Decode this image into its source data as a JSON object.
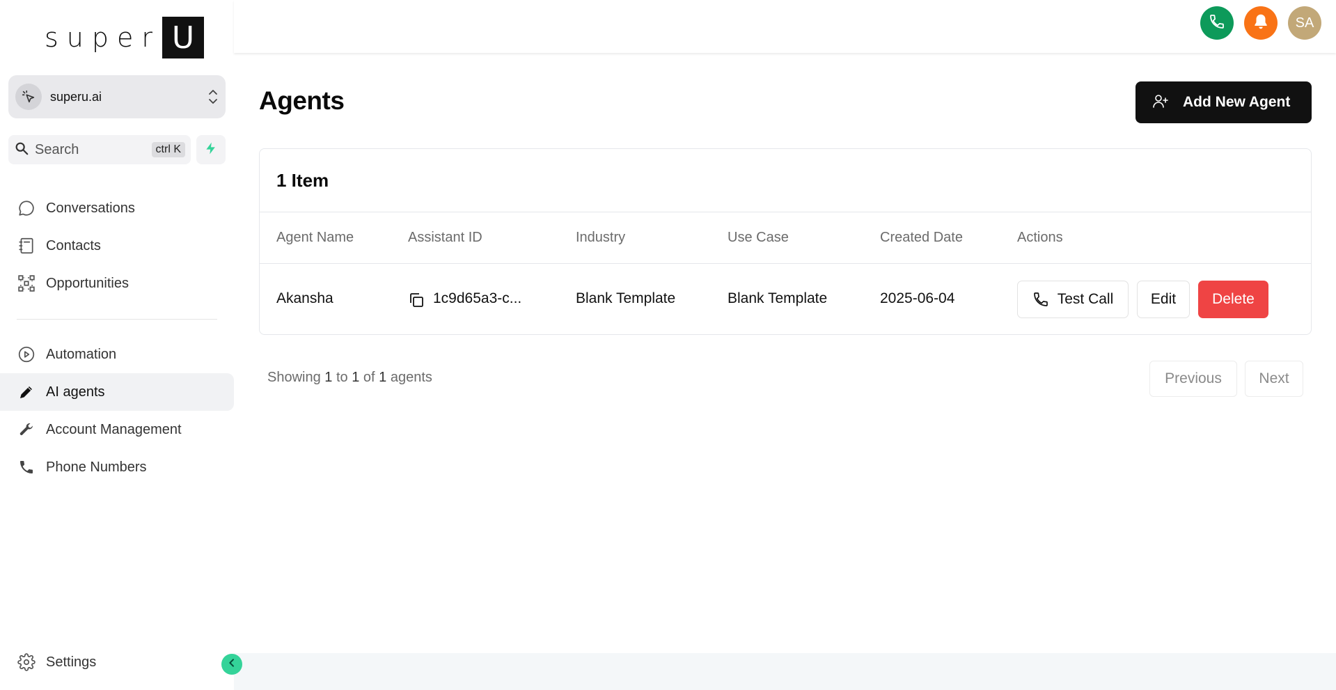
{
  "brand": {
    "logo_text": "super",
    "logo_box": "U"
  },
  "org": {
    "name": "superu.ai",
    "icon": "cursor-sparkle-icon"
  },
  "search": {
    "label": "Search",
    "shortcut": "ctrl K",
    "bolt_color": "#34d399"
  },
  "nav": {
    "primary": [
      {
        "label": "Conversations",
        "icon": "chat-bubble-icon"
      },
      {
        "label": "Contacts",
        "icon": "contact-book-icon"
      },
      {
        "label": "Opportunities",
        "icon": "network-icon"
      }
    ],
    "secondary": [
      {
        "label": "Automation",
        "icon": "play-circle-icon"
      },
      {
        "label": "AI agents",
        "icon": "pencil-icon",
        "active": true
      },
      {
        "label": "Account Management",
        "icon": "wrench-icon"
      },
      {
        "label": "Phone Numbers",
        "icon": "phone-icon"
      }
    ],
    "settings": {
      "label": "Settings",
      "icon": "gear-icon"
    }
  },
  "topbar": {
    "user_initials": "SA",
    "phone_color": "#0d9a5a",
    "bell_color": "#f97316",
    "avatar_color": "#c2a878"
  },
  "page": {
    "title": "Agents",
    "add_button": "Add New Agent"
  },
  "table": {
    "count_label": "1 Item",
    "headers": [
      "Agent Name",
      "Assistant ID",
      "Industry",
      "Use Case",
      "Created Date",
      "Actions"
    ],
    "rows": [
      {
        "agent_name": "Akansha",
        "assistant_id": "1c9d65a3-c...",
        "industry": "Blank Template",
        "use_case": "Blank Template",
        "created_date": "2025-06-04",
        "actions": {
          "test_call": "Test Call",
          "edit": "Edit",
          "delete": "Delete"
        }
      }
    ]
  },
  "pagination": {
    "prefix": "Showing",
    "from": "1",
    "to_word": "to",
    "to": "1",
    "of_word": "of",
    "total": "1",
    "suffix": "agents",
    "previous": "Previous",
    "next": "Next"
  },
  "colors": {
    "delete": "#ef4444",
    "primary_btn": "#111111",
    "accent": "#34d399"
  }
}
